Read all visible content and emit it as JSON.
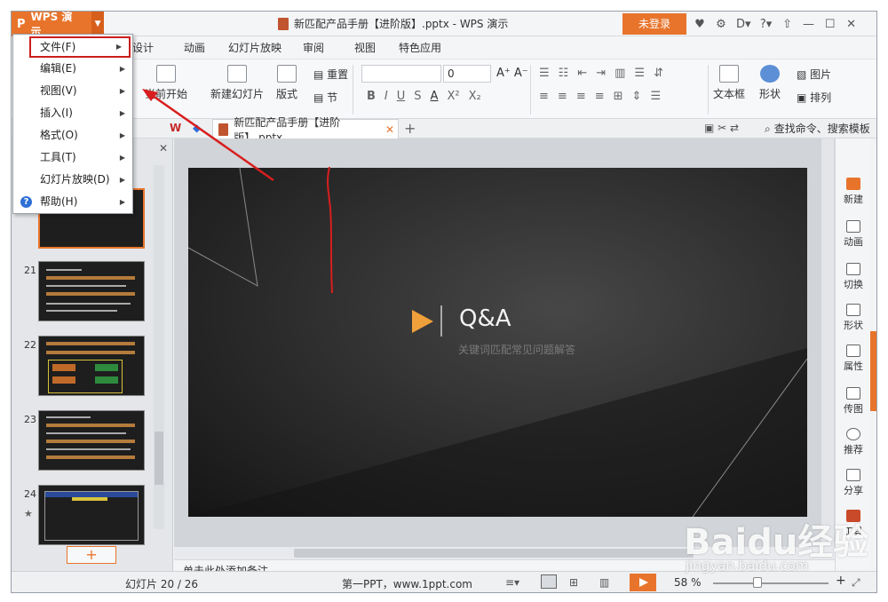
{
  "app": {
    "name": "WPS 演示",
    "document_title": "新匹配产品手册【进阶版】.pptx - WPS 演示",
    "login_label": "未登录"
  },
  "menu_tabs": [
    "设计",
    "动画",
    "幻灯片放映",
    "审阅",
    "视图",
    "特色应用"
  ],
  "ribbon": {
    "from_current": "当前开始",
    "new_slide": "新建幻灯片",
    "layout": "版式",
    "reset": "重置",
    "section": "节",
    "font_size": "0",
    "textbox": "文本框",
    "shape": "形状",
    "picture": "图片",
    "arrange": "排列"
  },
  "doc_tabs": {
    "active_tab": "新匹配产品手册【进阶版】.pptx",
    "search_label": "查找命令、搜索模板"
  },
  "dropdown_menu": [
    {
      "label": "文件(F)"
    },
    {
      "label": "编辑(E)"
    },
    {
      "label": "视图(V)"
    },
    {
      "label": "插入(I)"
    },
    {
      "label": "格式(O)"
    },
    {
      "label": "工具(T)"
    },
    {
      "label": "幻灯片放映(D)"
    },
    {
      "label": "帮助(H)"
    }
  ],
  "thumbnails": [
    {
      "number": "21"
    },
    {
      "number": "22"
    },
    {
      "number": "23"
    },
    {
      "number": "24"
    }
  ],
  "slide": {
    "title": "Q&A",
    "subtitle": "关键词匹配常见问题解答"
  },
  "notes_placeholder": "单击此处添加备注",
  "side_panel": [
    "新建",
    "动画",
    "切换",
    "形状",
    "属性",
    "传图",
    "推荐",
    "分享",
    "工具"
  ],
  "status": {
    "slide_counter": "幻灯片 20 / 26",
    "theme": "第一PPT，www.1ppt.com",
    "zoom": "58 %"
  },
  "watermark": {
    "brand": "Baidu经验",
    "url": "jingyan.baidu.com"
  },
  "colors": {
    "accent": "#e8742c",
    "highlight_box": "#cc1d1d",
    "annotation": "#d81e1e"
  }
}
